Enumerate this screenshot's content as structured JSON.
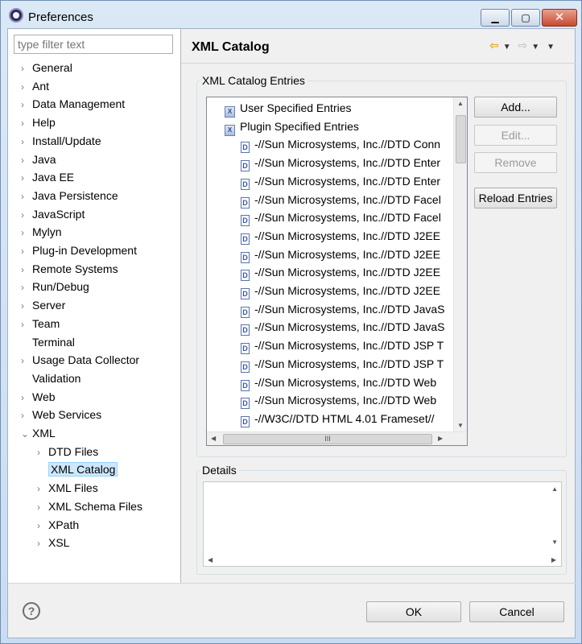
{
  "window": {
    "title": "Preferences"
  },
  "filter": {
    "placeholder": "type filter text"
  },
  "tree": [
    {
      "label": "General",
      "expander": "›"
    },
    {
      "label": "Ant",
      "expander": "›"
    },
    {
      "label": "Data Management",
      "expander": "›"
    },
    {
      "label": "Help",
      "expander": "›"
    },
    {
      "label": "Install/Update",
      "expander": "›"
    },
    {
      "label": "Java",
      "expander": "›"
    },
    {
      "label": "Java EE",
      "expander": "›"
    },
    {
      "label": "Java Persistence",
      "expander": "›"
    },
    {
      "label": "JavaScript",
      "expander": "›"
    },
    {
      "label": "Mylyn",
      "expander": "›"
    },
    {
      "label": "Plug-in Development",
      "expander": "›"
    },
    {
      "label": "Remote Systems",
      "expander": "›"
    },
    {
      "label": "Run/Debug",
      "expander": "›"
    },
    {
      "label": "Server",
      "expander": "›"
    },
    {
      "label": "Team",
      "expander": "›"
    },
    {
      "label": "Terminal",
      "expander": ""
    },
    {
      "label": "Usage Data Collector",
      "expander": "›"
    },
    {
      "label": "Validation",
      "expander": ""
    },
    {
      "label": "Web",
      "expander": "›"
    },
    {
      "label": "Web Services",
      "expander": "›"
    },
    {
      "label": "XML",
      "expander": "⌄"
    },
    {
      "label": "DTD Files",
      "expander": "›"
    },
    {
      "label": "XML Catalog",
      "expander": ""
    },
    {
      "label": "XML Files",
      "expander": "›"
    },
    {
      "label": "XML Schema Files",
      "expander": "›"
    },
    {
      "label": "XPath",
      "expander": "›"
    },
    {
      "label": "XSL",
      "expander": "›"
    }
  ],
  "page": {
    "title": "XML Catalog",
    "nav": {
      "back_icon": "back-arrow-icon",
      "forward_icon": "forward-arrow-icon"
    }
  },
  "catalog": {
    "group_label": "XML Catalog Entries",
    "categories": [
      "User Specified Entries",
      "Plugin Specified Entries"
    ],
    "entries": [
      "-//Sun Microsystems, Inc.//DTD Conn",
      "-//Sun Microsystems, Inc.//DTD Enter",
      "-//Sun Microsystems, Inc.//DTD Enter",
      "-//Sun Microsystems, Inc.//DTD Facel",
      "-//Sun Microsystems, Inc.//DTD Facel",
      "-//Sun Microsystems, Inc.//DTD J2EE",
      "-//Sun Microsystems, Inc.//DTD J2EE",
      "-//Sun Microsystems, Inc.//DTD J2EE",
      "-//Sun Microsystems, Inc.//DTD J2EE",
      "-//Sun Microsystems, Inc.//DTD JavaS",
      "-//Sun Microsystems, Inc.//DTD JavaS",
      "-//Sun Microsystems, Inc.//DTD JSP T",
      "-//Sun Microsystems, Inc.//DTD JSP T",
      "-//Sun Microsystems, Inc.//DTD Web",
      "-//Sun Microsystems, Inc.//DTD Web",
      "-//W3C//DTD HTML 4.01 Frameset//"
    ],
    "hscroll_grip": "III",
    "buttons": {
      "add": "Add...",
      "edit": "Edit...",
      "remove": "Remove",
      "reload": "Reload Entries"
    }
  },
  "details": {
    "label": "Details"
  },
  "footer": {
    "ok": "OK",
    "cancel": "Cancel",
    "help_glyph": "?"
  }
}
